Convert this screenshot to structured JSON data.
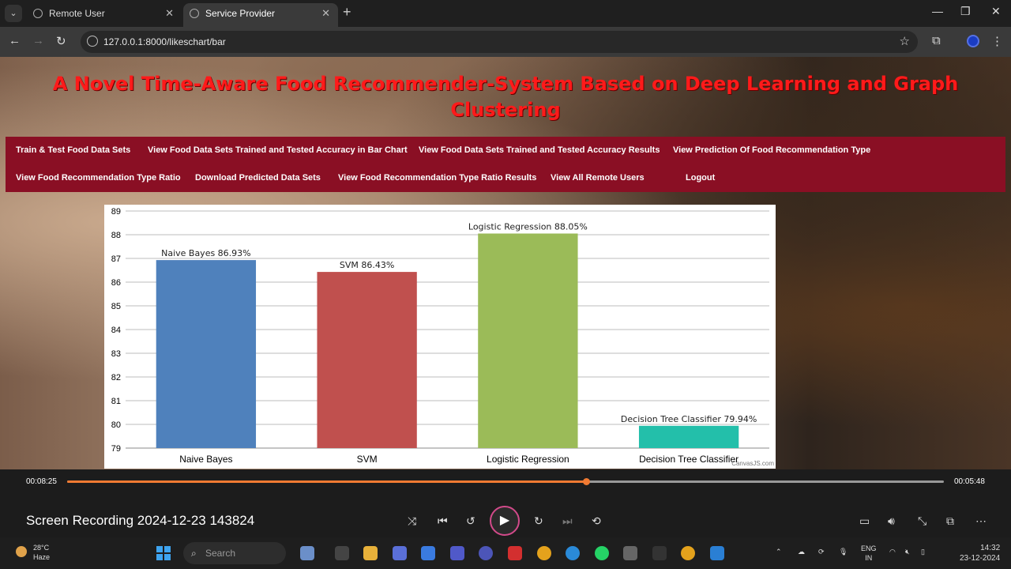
{
  "browser": {
    "tabs": [
      {
        "title": "Remote User",
        "active": false
      },
      {
        "title": "Service Provider",
        "active": true
      }
    ],
    "url": "127.0.0.1:8000/likeschart/bar"
  },
  "page": {
    "title": "A Novel Time-Aware Food Recommender-System Based on Deep Learning and Graph Clustering",
    "nav": [
      "Train & Test Food Data Sets",
      "View Food Data Sets Trained and Tested Accuracy in Bar Chart",
      "View Food Data Sets Trained and Tested Accuracy Results",
      "View Prediction Of Food Recommendation Type",
      "View Food Recommendation Type Ratio",
      "Download Predicted Data Sets",
      "View Food Recommendation Type Ratio Results",
      "View All Remote Users",
      "Logout"
    ],
    "chart_credit": "CanvasJS.com"
  },
  "chart_data": {
    "type": "bar",
    "categories": [
      "Naive Bayes",
      "SVM",
      "Logistic Regression",
      "Decision Tree Classifier"
    ],
    "values": [
      86.93,
      86.43,
      88.05,
      79.94
    ],
    "data_labels": [
      "Naive Bayes 86.93%",
      "SVM 86.43%",
      "Logistic Regression 88.05%",
      "Decision Tree Classifier 79.94%"
    ],
    "colors": [
      "#4f81bc",
      "#c0504e",
      "#9bbb58",
      "#23bfaa"
    ],
    "ylim": [
      79,
      89
    ],
    "yticks": [
      79,
      80,
      81,
      82,
      83,
      84,
      85,
      86,
      87,
      88,
      89
    ],
    "grid": true
  },
  "player": {
    "elapsed": "00:08:25",
    "remaining": "00:05:48",
    "progress": 0.592,
    "title": "Screen Recording 2024-12-23 143824"
  },
  "taskbar": {
    "weather_temp": "28°C",
    "weather_desc": "Haze",
    "search_placeholder": "Search",
    "lang_1": "ENG",
    "lang_2": "IN",
    "time": "14:32",
    "date": "23-12-2024"
  }
}
